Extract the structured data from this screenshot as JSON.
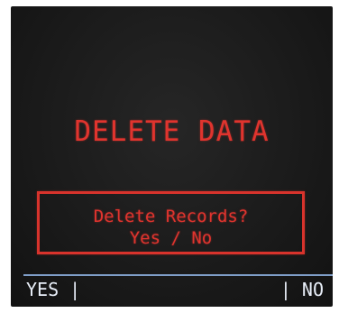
{
  "screen": {
    "title": "DELETE DATA",
    "dialog": {
      "line1": "Delete Records?",
      "line2": "Yes / No"
    }
  },
  "softkeys": {
    "left_label": "YES |",
    "right_label": "| NO"
  },
  "colors": {
    "text_accent": "#e0342e",
    "softkey_text": "#e8eef8",
    "softbar_rule": "#7f9ec8",
    "screen_bg": "#1b1b1b"
  }
}
